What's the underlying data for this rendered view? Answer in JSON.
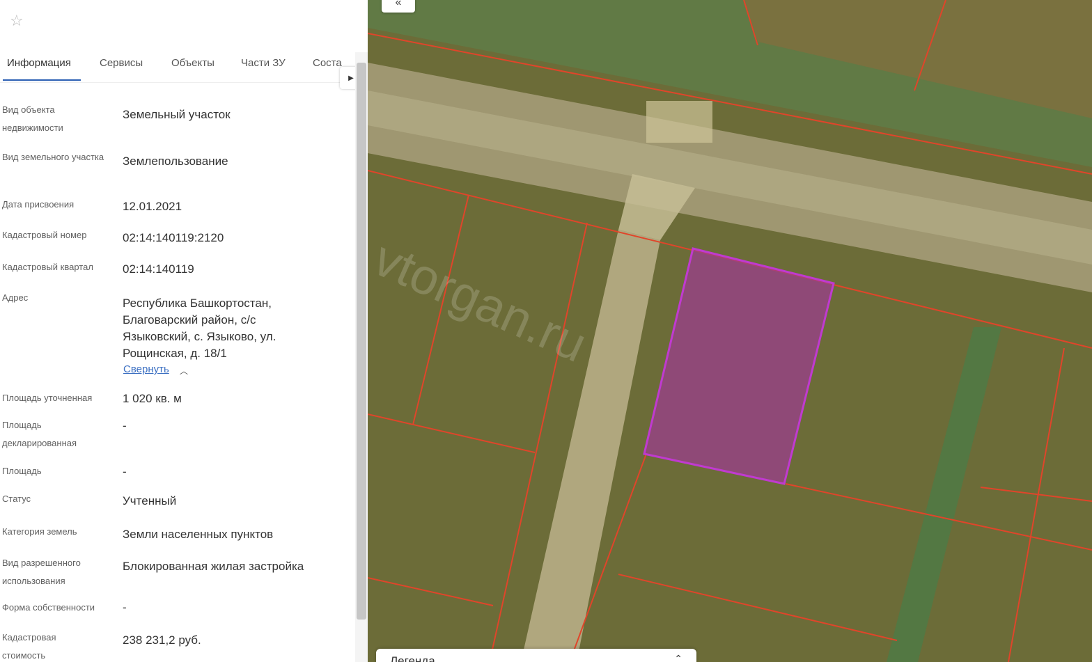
{
  "panel": {
    "star_icon": "star-outline-icon",
    "tabs": [
      "Информация",
      "Сервисы",
      "Объекты",
      "Части ЗУ",
      "Соста"
    ],
    "tab_next_icon": "chevron-right-icon",
    "fields": [
      {
        "label": "Вид объекта недвижимости",
        "value": "Земельный участок"
      },
      {
        "label": "Вид земельного участка",
        "value": "Землепользование"
      },
      {
        "label": "Дата присвоения",
        "value": "12.01.2021"
      },
      {
        "label": "Кадастровый номер",
        "value": "02:14:140119:2120"
      },
      {
        "label": "Кадастровый квартал",
        "value": "02:14:140119"
      },
      {
        "label": "Адрес",
        "value": "Республика Башкортостан, Благоварский район, с/с Языковский, с. Языково, ул. Рощинская, д. 18/1"
      },
      {
        "label": "Площадь уточненная",
        "value": "1 020 кв. м"
      },
      {
        "label": "Площадь декларированная",
        "value": "-"
      },
      {
        "label": "Площадь",
        "value": "-"
      },
      {
        "label": "Статус",
        "value": "Учтенный"
      },
      {
        "label": "Категория земель",
        "value": "Земли населенных пунктов"
      },
      {
        "label": "Вид разрешенного использования",
        "value": "Блокированная жилая застройка"
      },
      {
        "label": "Форма собственности",
        "value": "-"
      },
      {
        "label": "Кадастровая стоимость",
        "value": "238 231,2 руб."
      }
    ],
    "collapse_link": "Свернуть",
    "collapse_icon": "chevron-up-icon"
  },
  "map": {
    "collapse_button": "«",
    "watermark": "vtorgan.ru",
    "legend_title": "Легенда",
    "legend_toggle": "⌃",
    "colors": {
      "boundary": "#e0452a",
      "selected_fill": "#9b3d8c",
      "selected_stroke": "#c03ad0",
      "road": "#b9b08a",
      "field": "#6f7039",
      "green_strip": "#4f7a45"
    }
  }
}
